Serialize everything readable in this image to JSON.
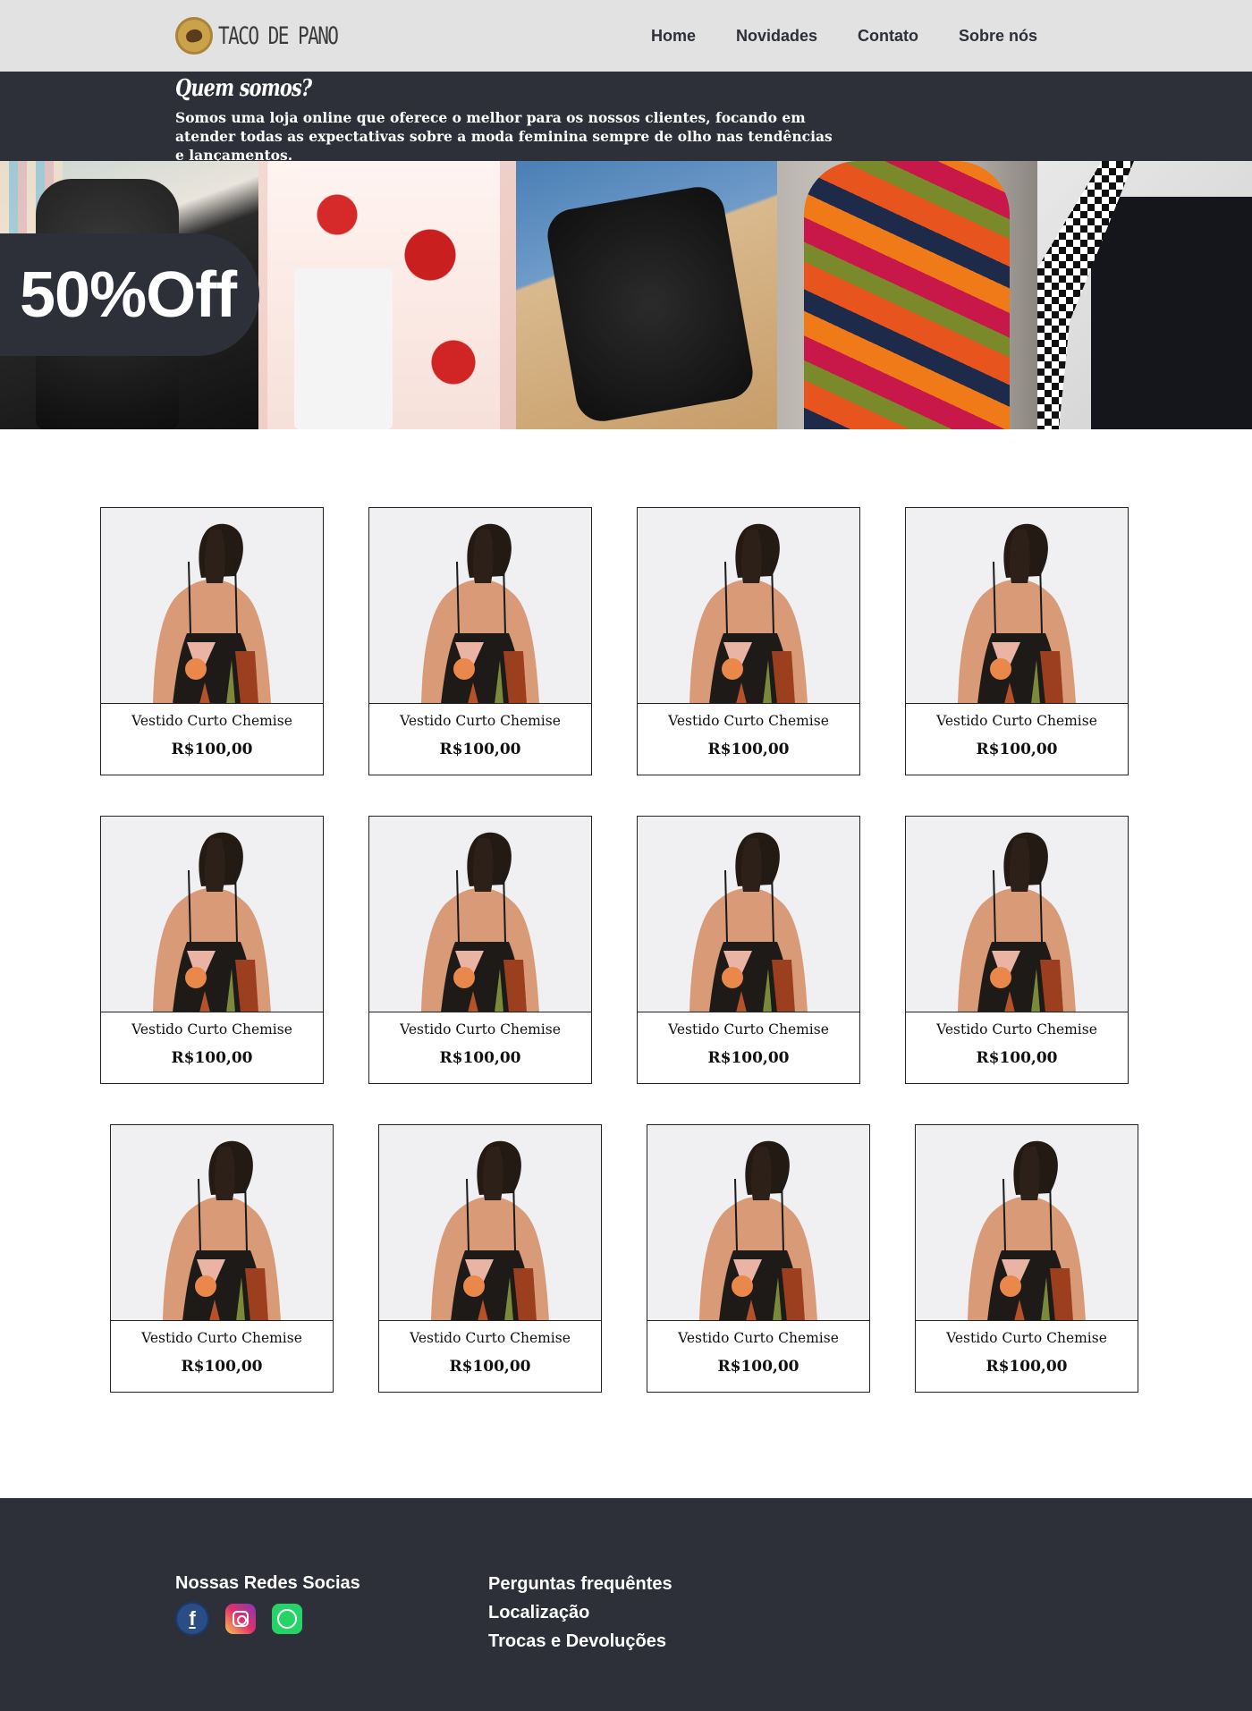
{
  "header": {
    "logo_text": "TACO DE PANO",
    "nav": [
      "Home",
      "Novidades",
      "Contato",
      "Sobre nós"
    ]
  },
  "about": {
    "title": "Quem somos?",
    "text": "Somos uma loja online que oferece o melhor para os nossos clientes, focando em atender todas as expectativas sobre a moda feminina sempre de olho nas tendências e lançamentos."
  },
  "banner": {
    "badge": "50%Off"
  },
  "products": [
    {
      "name": "Vestido Curto Chemise",
      "price": "R$100,00"
    },
    {
      "name": "Vestido Curto Chemise",
      "price": "R$100,00"
    },
    {
      "name": "Vestido Curto Chemise",
      "price": "R$100,00"
    },
    {
      "name": "Vestido Curto Chemise",
      "price": "R$100,00"
    },
    {
      "name": "Vestido Curto Chemise",
      "price": "R$100,00"
    },
    {
      "name": "Vestido Curto Chemise",
      "price": "R$100,00"
    },
    {
      "name": "Vestido Curto Chemise",
      "price": "R$100,00"
    },
    {
      "name": "Vestido Curto Chemise",
      "price": "R$100,00"
    },
    {
      "name": "Vestido Curto Chemise",
      "price": "R$100,00"
    },
    {
      "name": "Vestido Curto Chemise",
      "price": "R$100,00"
    },
    {
      "name": "Vestido Curto Chemise",
      "price": "R$100,00"
    },
    {
      "name": "Vestido Curto Chemise",
      "price": "R$100,00"
    }
  ],
  "footer": {
    "social_title": "Nossas Redes Socias",
    "social_icons": [
      "facebook-icon",
      "instagram-icon",
      "whatsapp-icon"
    ],
    "links": [
      "Perguntas frequêntes",
      "Localização",
      "Trocas e Devoluções"
    ]
  },
  "colors": {
    "dark": "#2d3039",
    "header_bg": "#e2e2e2"
  }
}
